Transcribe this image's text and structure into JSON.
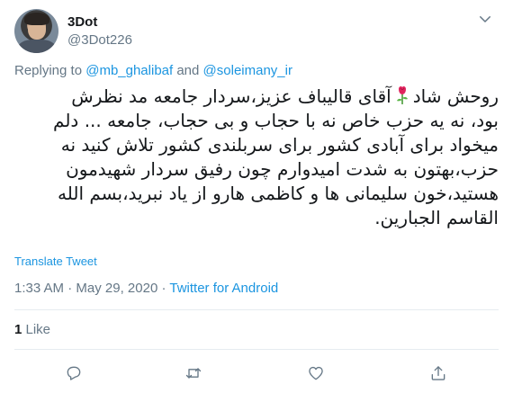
{
  "user": {
    "display_name": "3Dot",
    "handle": "@3Dot226"
  },
  "reply": {
    "prefix": "Replying to ",
    "mention_1": "@mb_ghalibaf",
    "conjunction": " and ",
    "mention_2": "@soleimany_ir"
  },
  "tweet": {
    "lines": [
      {
        "before_icon": "روحش شاد",
        "after_icon": "آقای قالیباف عزیز،سردار جامعه مد نظرش"
      },
      {
        "text": "بود، نه یه حزب خاص نه با حجاب و بی حجاب، جامعه ... دلم"
      },
      {
        "text": "میخواد برای آبادی کشور برای سربلندی کشور تلاش کنید نه"
      },
      {
        "text": "حزب،بهتون به شدت امیدوارم چون رفیق سردار شهیدمون"
      },
      {
        "text": "هستید،خون سلیمانی ها و کاظمی هارو از یاد نبرید،بسم الله"
      },
      {
        "text": "القاسم الجبارین."
      }
    ],
    "emoji_icon": "rose-icon"
  },
  "translate_label": "Translate Tweet",
  "meta": {
    "time": "1:33 AM",
    "separator_1": " · ",
    "date": "May 29, 2020",
    "separator_2": " · ",
    "source": "Twitter for Android"
  },
  "stats": {
    "like_count": "1",
    "like_label": " Like"
  },
  "actions": [
    {
      "name": "reply",
      "icon": "reply-icon"
    },
    {
      "name": "retweet",
      "icon": "retweet-icon"
    },
    {
      "name": "like",
      "icon": "heart-icon"
    },
    {
      "name": "share",
      "icon": "share-icon"
    }
  ],
  "colors": {
    "accent": "#1b95e0",
    "secondary_text": "#657786",
    "primary_text": "#14171a",
    "divider": "#e6ecf0"
  }
}
